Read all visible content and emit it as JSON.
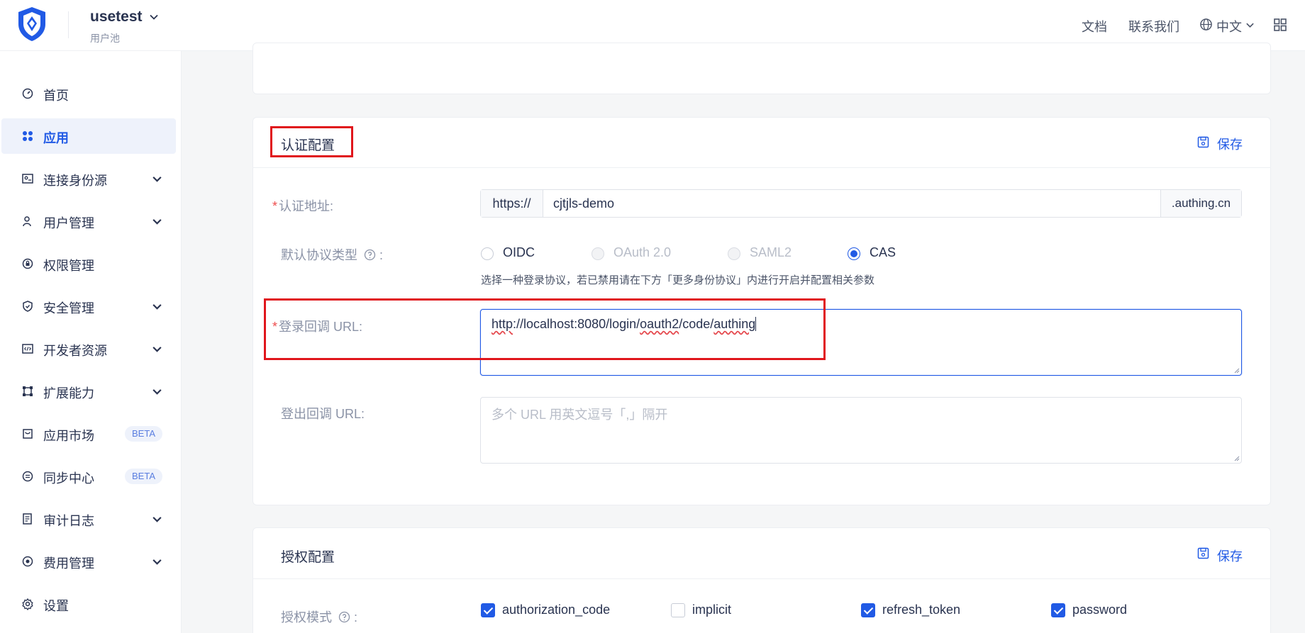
{
  "header": {
    "pool_name": "usetest",
    "pool_sub": "用户池",
    "links": [
      "文档",
      "联系我们"
    ],
    "language": "中文"
  },
  "sidebar": {
    "items": [
      {
        "label": "首页",
        "icon": "dashboard-icon",
        "chevron": false,
        "active": false
      },
      {
        "label": "应用",
        "icon": "apps-icon",
        "chevron": false,
        "active": true
      },
      {
        "label": "连接身份源",
        "icon": "id-card-icon",
        "chevron": true,
        "active": false
      },
      {
        "label": "用户管理",
        "icon": "user-icon",
        "chevron": true,
        "active": false
      },
      {
        "label": "权限管理",
        "icon": "lock-icon",
        "chevron": false,
        "active": false
      },
      {
        "label": "安全管理",
        "icon": "shield-icon",
        "chevron": true,
        "active": false
      },
      {
        "label": "开发者资源",
        "icon": "code-icon",
        "chevron": true,
        "active": false
      },
      {
        "label": "扩展能力",
        "icon": "extension-icon",
        "chevron": true,
        "active": false
      },
      {
        "label": "应用市场",
        "icon": "market-icon",
        "chevron": false,
        "active": false,
        "badge": "BETA"
      },
      {
        "label": "同步中心",
        "icon": "sync-icon",
        "chevron": false,
        "active": false,
        "badge": "BETA"
      },
      {
        "label": "审计日志",
        "icon": "log-icon",
        "chevron": true,
        "active": false
      },
      {
        "label": "费用管理",
        "icon": "billing-icon",
        "chevron": true,
        "active": false
      },
      {
        "label": "设置",
        "icon": "gear-icon",
        "chevron": false,
        "active": false
      }
    ]
  },
  "auth_config": {
    "title": "认证配置",
    "save_label": "保存",
    "auth_address": {
      "label": "认证地址:",
      "prefix": "https://",
      "value": "cjtjls-demo",
      "suffix": ".authing.cn"
    },
    "protocol": {
      "label": "默认协议类型",
      "colon": ":",
      "options": [
        {
          "label": "OIDC",
          "state": "unchecked"
        },
        {
          "label": "OAuth 2.0",
          "state": "disabled"
        },
        {
          "label": "SAML2",
          "state": "disabled"
        },
        {
          "label": "CAS",
          "state": "checked"
        }
      ],
      "hint": "选择一种登录协议，若已禁用请在下方「更多身份协议」内进行开启并配置相关参数"
    },
    "login_callback": {
      "label": "登录回调 URL:",
      "value_parts": [
        "http",
        "://localhost:8080/login/",
        "oauth2",
        "/code/",
        "authing"
      ]
    },
    "logout_callback": {
      "label": "登出回调 URL:",
      "placeholder": "多个 URL 用英文逗号「,」隔开"
    }
  },
  "grant_config": {
    "title": "授权配置",
    "save_label": "保存",
    "mode_label": "授权模式",
    "colon": ":",
    "options": [
      {
        "label": "authorization_code",
        "checked": true
      },
      {
        "label": "implicit",
        "checked": false
      },
      {
        "label": "refresh_token",
        "checked": true
      },
      {
        "label": "password",
        "checked": true
      }
    ]
  },
  "colors": {
    "primary": "#215ae5",
    "highlight": "#e0161c"
  }
}
